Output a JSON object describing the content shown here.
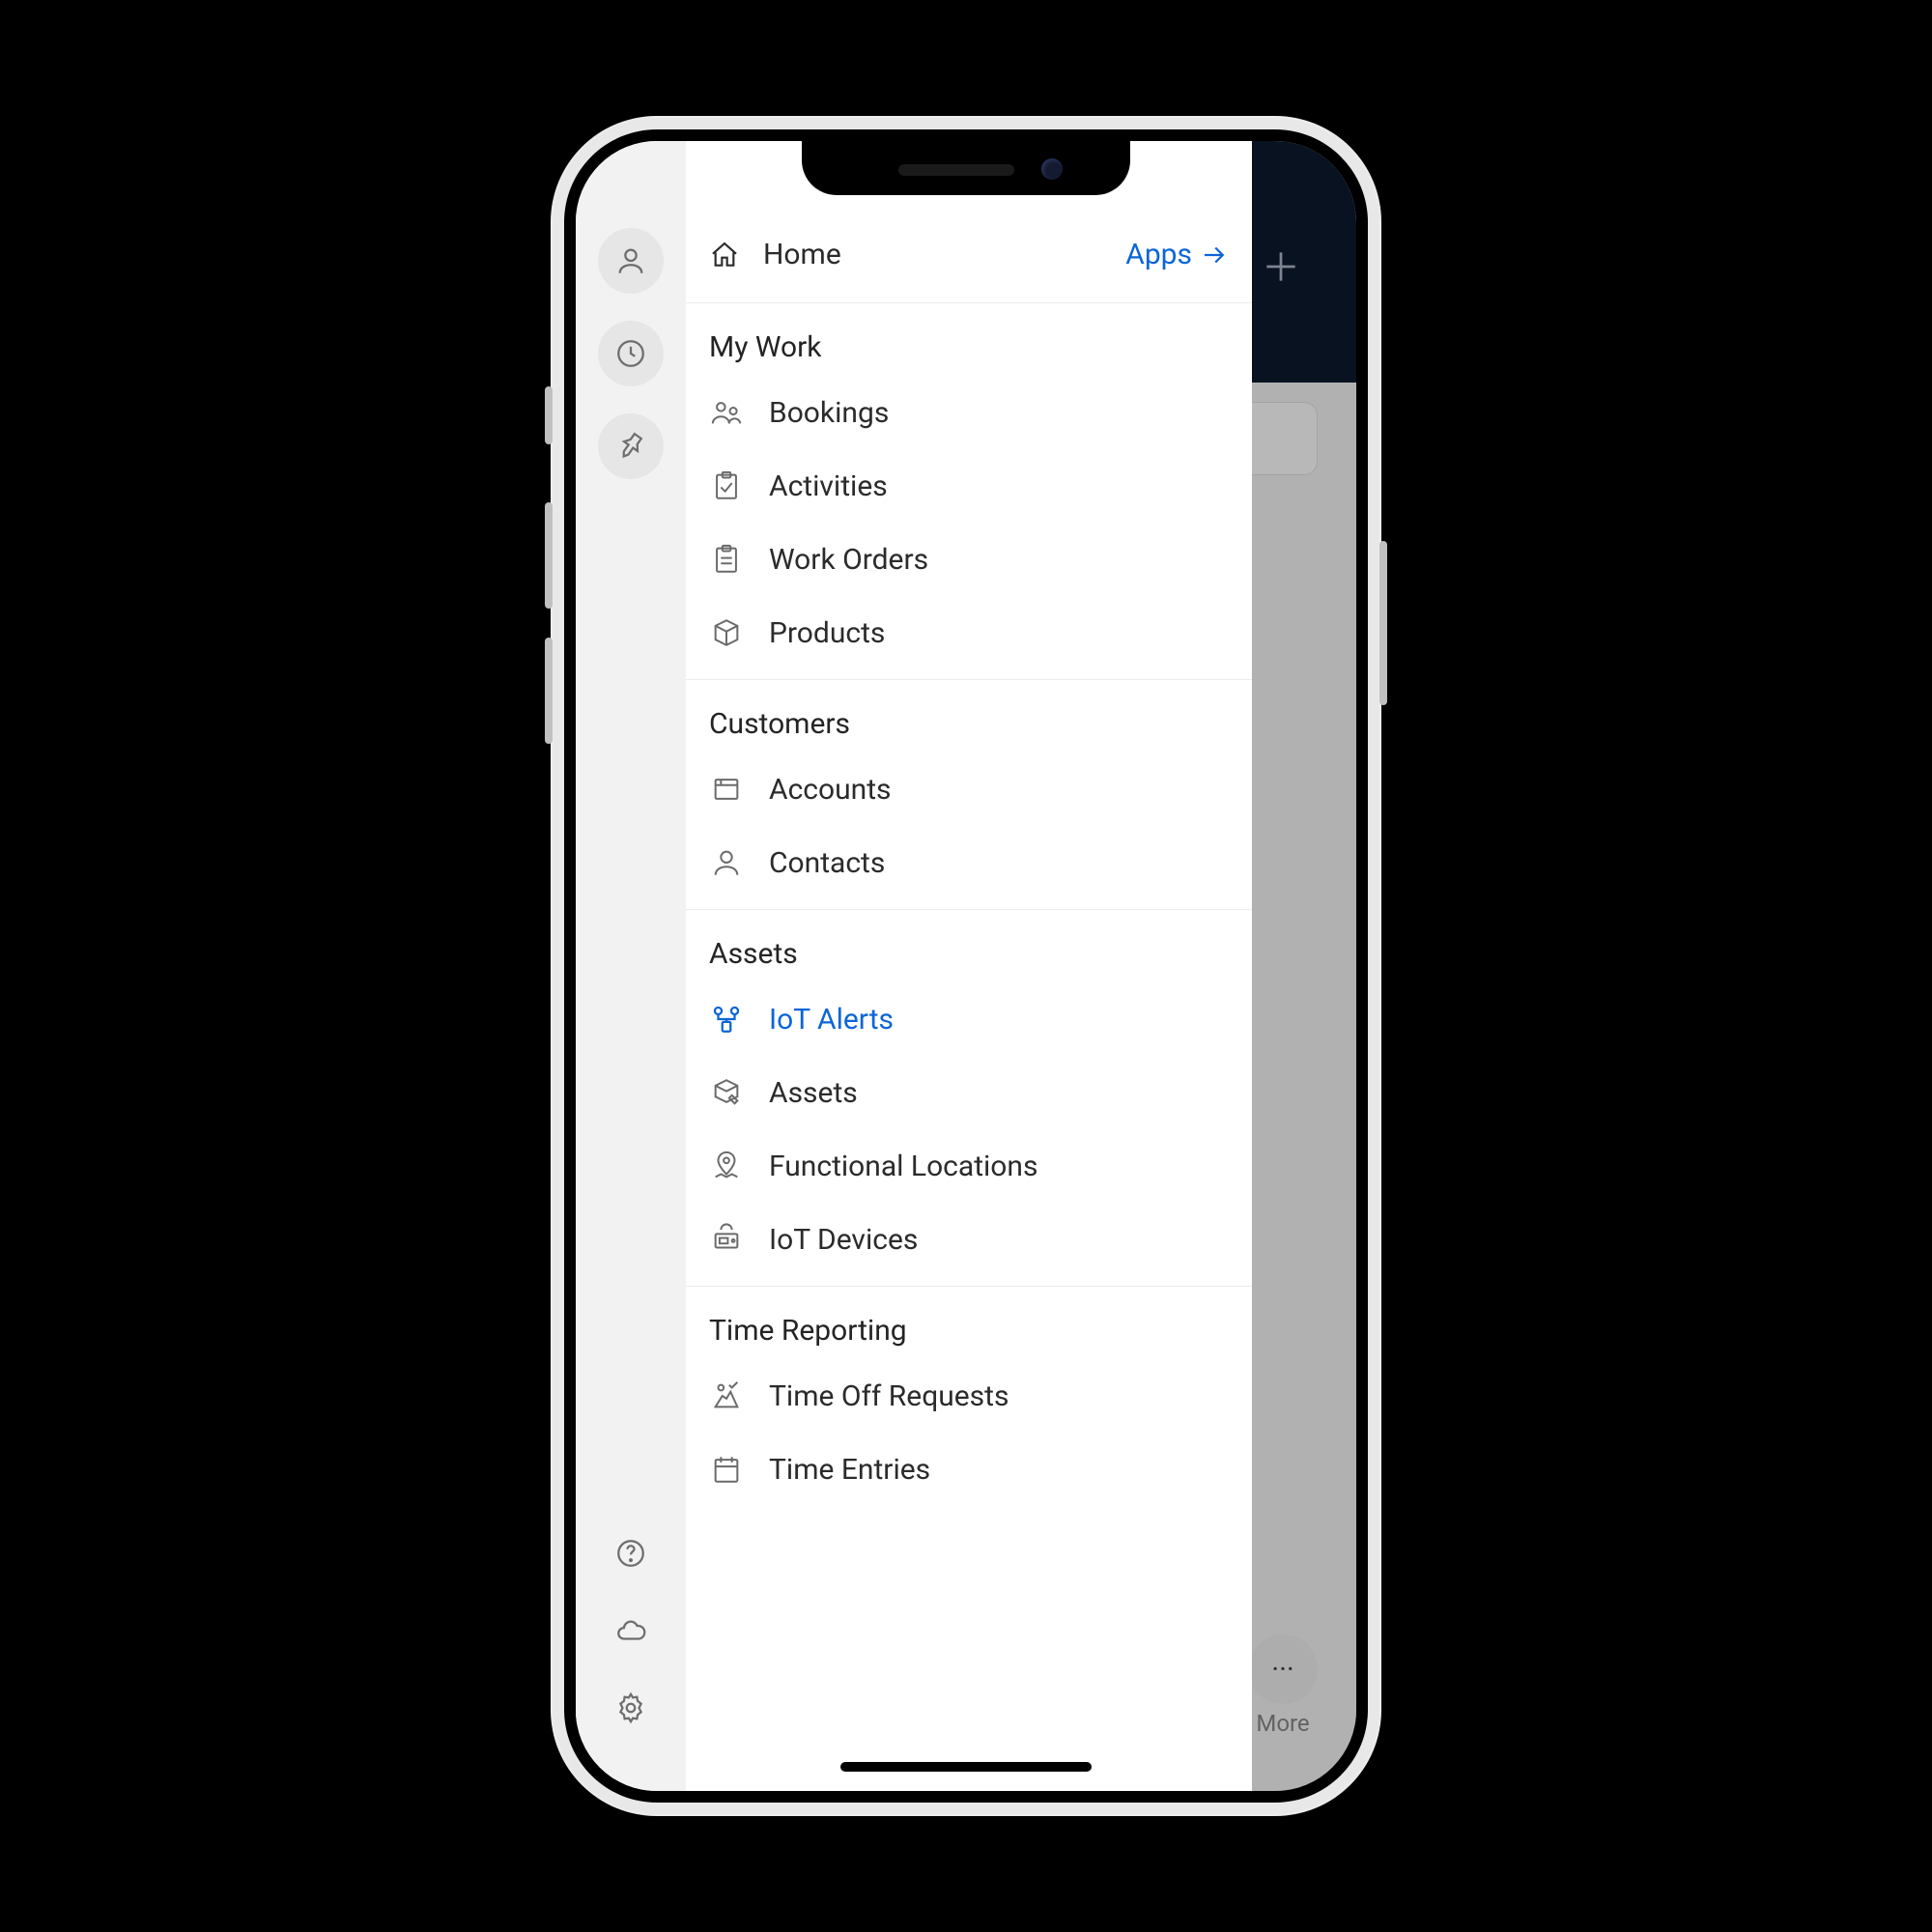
{
  "header": {
    "home_label": "Home",
    "apps_label": "Apps"
  },
  "sections": {
    "my_work_title": "My Work",
    "customers_title": "Customers",
    "assets_title": "Assets",
    "time_reporting_title": "Time Reporting"
  },
  "items": {
    "bookings": "Bookings",
    "activities": "Activities",
    "work_orders": "Work Orders",
    "products": "Products",
    "accounts": "Accounts",
    "contacts": "Contacts",
    "iot_alerts": "IoT Alerts",
    "assets": "Assets",
    "functional_locations": "Functional Locations",
    "iot_devices": "IoT Devices",
    "time_off_requests": "Time Off Requests",
    "time_entries": "Time Entries"
  },
  "underlay": {
    "more_label": "More"
  }
}
